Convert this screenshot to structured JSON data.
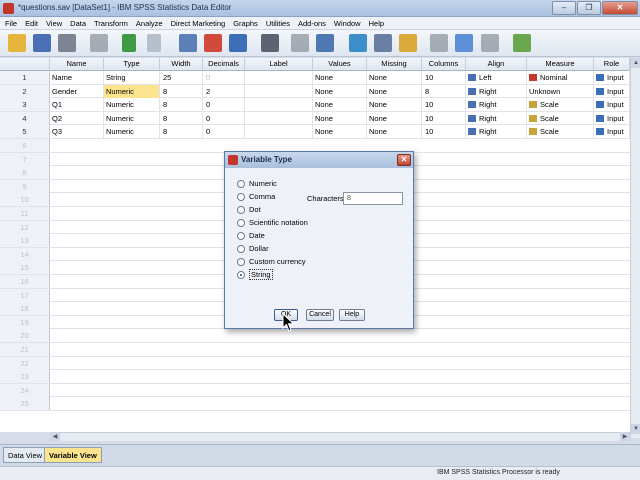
{
  "window": {
    "title": "*questions.sav [DataSet1] - IBM SPSS Statistics Data Editor",
    "controls": [
      "–",
      "❐",
      "✕"
    ]
  },
  "menu": [
    "File",
    "Edit",
    "View",
    "Data",
    "Transform",
    "Analyze",
    "Direct Marketing",
    "Graphs",
    "Utilities",
    "Add-ons",
    "Window",
    "Help"
  ],
  "grid": {
    "columns": [
      "Name",
      "Type",
      "Width",
      "Decimals",
      "Label",
      "Values",
      "Missing",
      "Columns",
      "Align",
      "Measure",
      "Role"
    ],
    "rows": [
      {
        "num": "1",
        "name": "Name",
        "type": "String",
        "width": "25",
        "decimals": "0",
        "label": "",
        "values": "None",
        "missing": "None",
        "columns": "10",
        "align": "Left",
        "measure": "Nominal",
        "role": "Input"
      },
      {
        "num": "2",
        "name": "Gender",
        "type": "Numeric",
        "width": "8",
        "decimals": "2",
        "label": "",
        "values": "None",
        "missing": "None",
        "columns": "8",
        "align": "Right",
        "measure": "Unknown",
        "role": "Input"
      },
      {
        "num": "3",
        "name": "Q1",
        "type": "Numeric",
        "width": "8",
        "decimals": "0",
        "label": "",
        "values": "None",
        "missing": "None",
        "columns": "10",
        "align": "Right",
        "measure": "Scale",
        "role": "Input"
      },
      {
        "num": "4",
        "name": "Q2",
        "type": "Numeric",
        "width": "8",
        "decimals": "0",
        "label": "",
        "values": "None",
        "missing": "None",
        "columns": "10",
        "align": "Right",
        "measure": "Scale",
        "role": "Input"
      },
      {
        "num": "5",
        "name": "Q3",
        "type": "Numeric",
        "width": "8",
        "decimals": "0",
        "label": "",
        "values": "None",
        "missing": "None",
        "columns": "10",
        "align": "Right",
        "measure": "Scale",
        "role": "Input"
      }
    ],
    "empty_rows": [
      "6",
      "7",
      "8",
      "9",
      "10",
      "11",
      "12",
      "13",
      "14",
      "15",
      "16",
      "17",
      "18",
      "19",
      "20",
      "21",
      "22",
      "23",
      "24",
      "25"
    ]
  },
  "dialog": {
    "title": "Variable Type",
    "options": [
      "Numeric",
      "Comma",
      "Dot",
      "Scientific notation",
      "Date",
      "Dollar",
      "Custom currency",
      "String"
    ],
    "selected": "String",
    "characters_label": "Characters:",
    "characters_value": "8",
    "ok": "OK",
    "cancel": "Cancel",
    "help": "Help"
  },
  "tabs": {
    "data_view": "Data View",
    "variable_view": "Variable View"
  },
  "status": "IBM SPSS Statistics Processor is ready",
  "colors": {
    "selected_cell": "#fce48e",
    "title_bar": "#b3c7e3"
  }
}
